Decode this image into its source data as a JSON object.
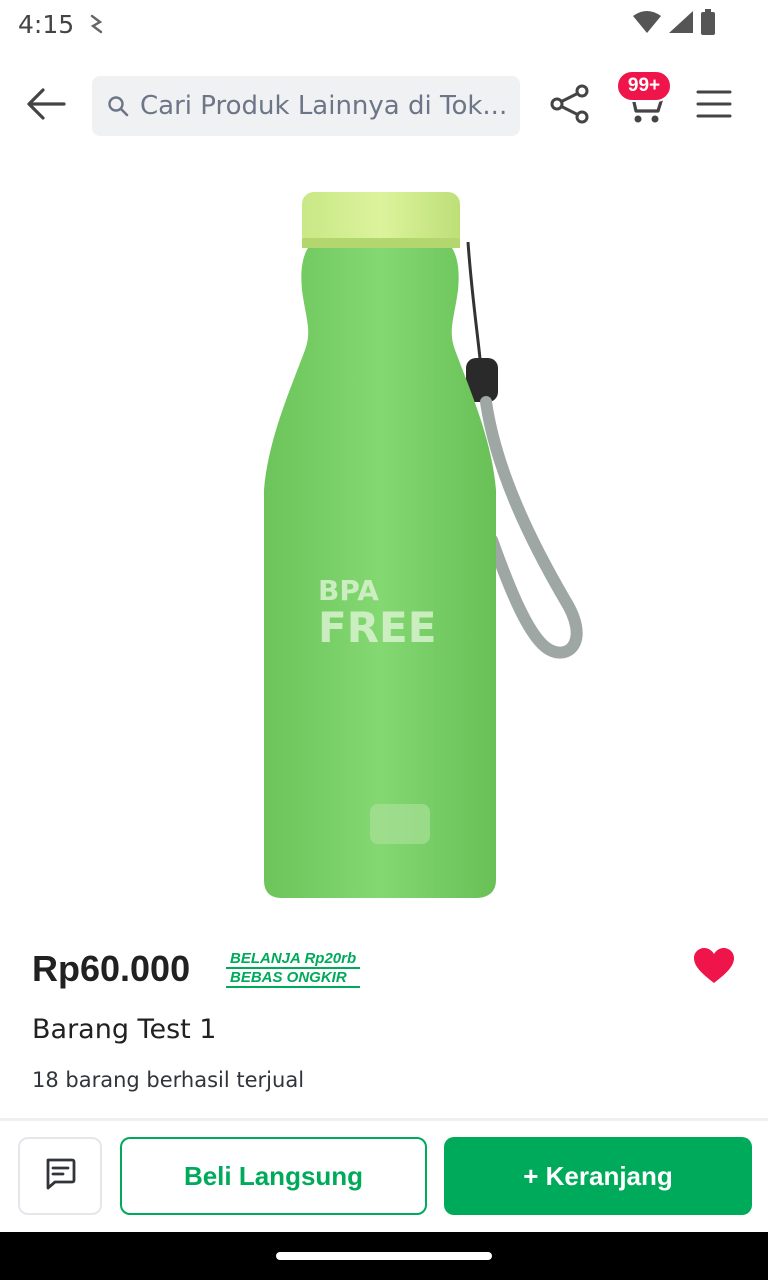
{
  "status_bar": {
    "time": "4:15",
    "icons": [
      "notification-icon",
      "wifi-icon",
      "signal-icon",
      "battery-icon"
    ]
  },
  "top_bar": {
    "back_icon": "arrow-left-icon",
    "search_placeholder": "Cari Produk Lainnya di Tok...",
    "share_icon": "share-icon",
    "cart_icon": "cart-icon",
    "cart_badge": "99+",
    "menu_icon": "hamburger-menu-icon"
  },
  "product": {
    "image": "green-water-bottle",
    "price": "Rp60.000",
    "promo_line1": "BELANJA Rp20rb",
    "promo_line2": "BEBAS ONGKIR",
    "name": "Barang Test 1",
    "sold": "18 barang berhasil terjual",
    "wishlisted": true
  },
  "actions": {
    "chat_icon": "chat-icon",
    "buy_now": "Beli Langsung",
    "add_to_cart": "+ Keranjang"
  },
  "colors": {
    "primary_green": "#00aa5b",
    "badge_red": "#ef144a",
    "heart_red": "#ef144a",
    "bottle_green": "#7bd36a"
  }
}
